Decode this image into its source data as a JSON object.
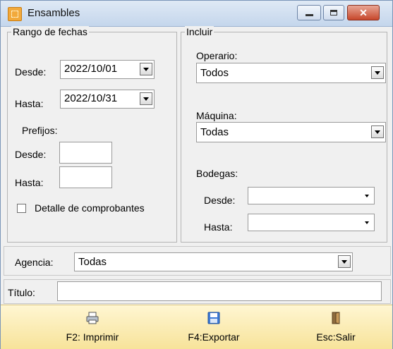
{
  "window": {
    "title": "Ensambles",
    "icon": "app-icon",
    "controls": [
      "minimize-icon",
      "maximize-icon",
      "close-icon"
    ]
  },
  "rango_fechas": {
    "legend": "Rango de fechas",
    "desde_label": "Desde:",
    "desde_value": "2022/10/01",
    "hasta_label": "Hasta:",
    "hasta_value": "2022/10/31",
    "prefijos_label": "Prefijos:",
    "prefijo_desde_label": "Desde:",
    "prefijo_desde_value": "",
    "prefijo_hasta_label": "Hasta:",
    "prefijo_hasta_value": "",
    "detalle_label": "Detalle de comprobantes",
    "detalle_checked": false
  },
  "incluir": {
    "legend": "Incluir",
    "operario_label": "Operario:",
    "operario_value": "Todos",
    "maquina_label": "Máquina:",
    "maquina_value": "Todas",
    "bodegas_label": "Bodegas:",
    "bodega_desde_label": "Desde:",
    "bodega_desde_value": "",
    "bodega_hasta_label": "Hasta:",
    "bodega_hasta_value": ""
  },
  "agencia": {
    "label": "Agencia:",
    "value": "Todas"
  },
  "titulo": {
    "label": "Título:",
    "value": ""
  },
  "toolbar": {
    "imprimir_label": "F2: Imprimir",
    "exportar_label": "F4:Exportar",
    "salir_label": "Esc:Salir"
  }
}
